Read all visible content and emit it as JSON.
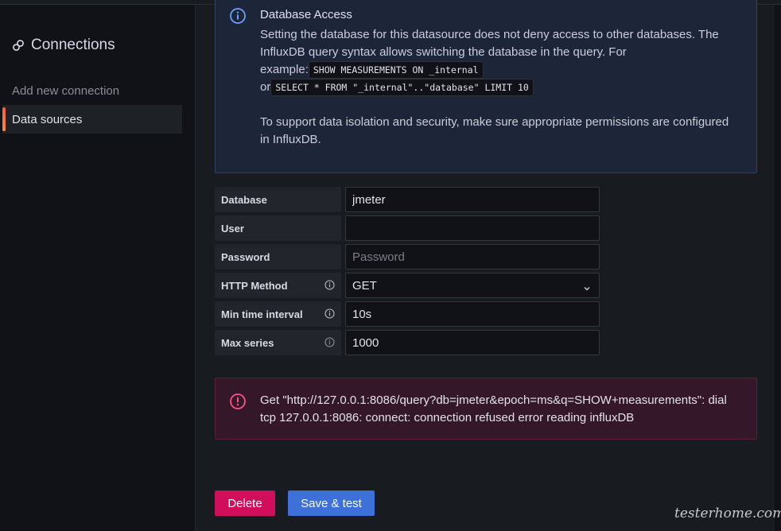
{
  "sidebar": {
    "title": "Connections",
    "items": [
      {
        "label": "Add new connection"
      },
      {
        "label": "Data sources"
      }
    ]
  },
  "info_alert": {
    "title": "Database Access",
    "line1": "Setting the database for this datasource does not deny access to other databases. The",
    "line2": "InfluxDB query syntax allows switching the database in the query. For",
    "line3_prefix": "example:",
    "code1": "SHOW MEASUREMENTS ON _internal",
    "line4_prefix": "or",
    "code2": "SELECT * FROM \"_internal\"..\"database\" LIMIT 10",
    "line5": "To support data isolation and security, make sure appropriate permissions are configured",
    "line6": "in InfluxDB."
  },
  "form": {
    "database": {
      "label": "Database",
      "value": "jmeter"
    },
    "user": {
      "label": "User",
      "value": ""
    },
    "password": {
      "label": "Password",
      "placeholder": "Password"
    },
    "http_method": {
      "label": "HTTP Method",
      "value": "GET"
    },
    "min_time_interval": {
      "label": "Min time interval",
      "value": "10s"
    },
    "max_series": {
      "label": "Max series",
      "value": "1000"
    }
  },
  "error_alert": {
    "text": "Get \"http://127.0.0.1:8086/query?db=jmeter&epoch=ms&q=SHOW+measurements\": dial tcp 127.0.0.1:8086: connect: connection refused error reading influxDB"
  },
  "buttons": {
    "delete": "Delete",
    "save_test": "Save & test"
  },
  "watermark": "testerhome.com",
  "colors": {
    "accent": "#3d71d9",
    "danger": "#d10e5c",
    "info_icon": "#6e9fff",
    "error_icon": "#ff5286"
  },
  "icons": {
    "sidebar_title": "connections-icon",
    "info": "info-circle-icon",
    "error": "exclamation-circle-icon",
    "tooltip": "info-circle-small-icon",
    "select": "chevron-down-icon"
  }
}
